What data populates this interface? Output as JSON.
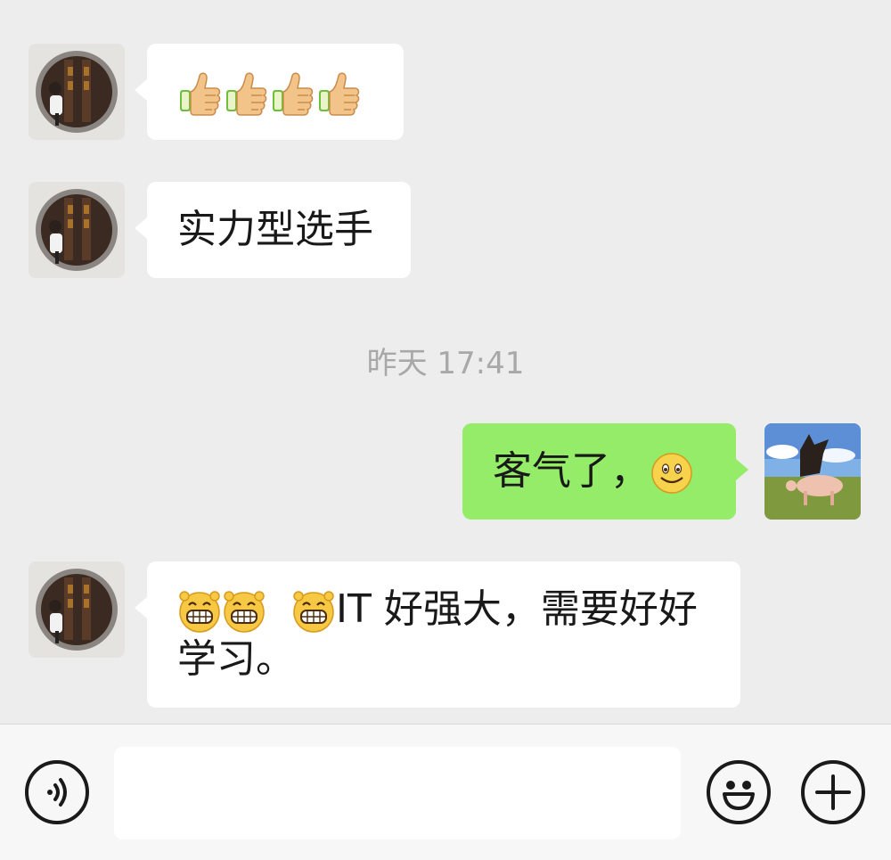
{
  "messages": [
    {
      "side": "in",
      "avatar": "avatar-contact",
      "content_icons": [
        "thumbs-up-icon",
        "thumbs-up-icon",
        "thumbs-up-icon",
        "thumbs-up-icon"
      ]
    },
    {
      "side": "in",
      "avatar": "avatar-contact",
      "text": "实力型选手"
    },
    {
      "side": "out",
      "avatar": "avatar-self",
      "text": "客气了，",
      "content_icons": [
        "smile-icon"
      ]
    },
    {
      "side": "in",
      "avatar": "avatar-contact",
      "content_icons": [
        "grin-icon",
        "grin-icon",
        "grin-icon"
      ],
      "text": "IT 好强大，需要好好",
      "text_line2": "学习。"
    }
  ],
  "timestamp": "昨天 17:41",
  "input_bar": {
    "voice_icon": "voice-icon",
    "text_value": "",
    "emoji_icon": "emoji-icon",
    "plus_icon": "plus-icon"
  },
  "colors": {
    "background": "#ededed",
    "bubble_in": "#ffffff",
    "bubble_out": "#95ec69",
    "timestamp": "#a8a8a8"
  }
}
